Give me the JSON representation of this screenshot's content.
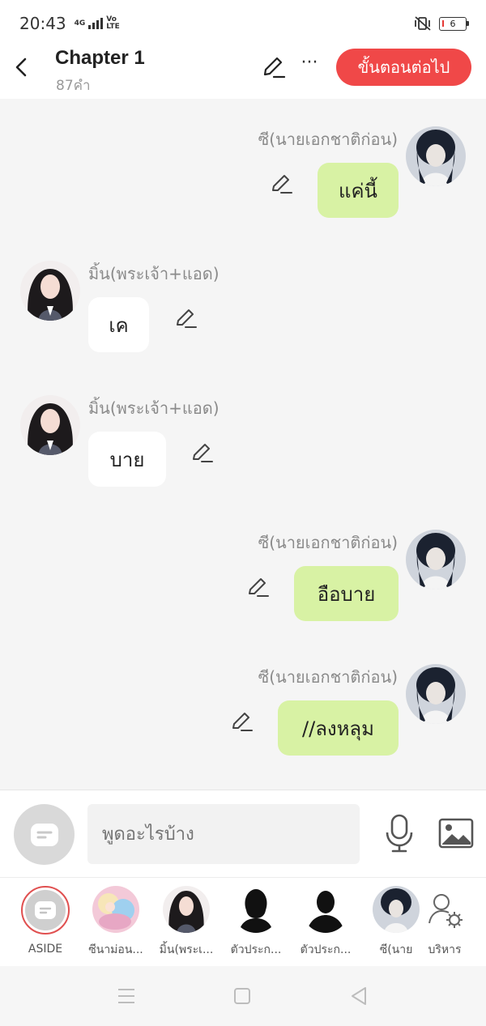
{
  "status_bar": {
    "time": "20:43",
    "network": "4G",
    "volte": "Vo LTE",
    "battery": "6"
  },
  "header": {
    "title": "Chapter 1",
    "word_count": "87คำ",
    "next_button": "ขั้นตอนต่อไป",
    "more_label": "···"
  },
  "messages": [
    {
      "side": "right",
      "name": "ซี(นายเอกชาติก่อน)",
      "text": "แค่นี้"
    },
    {
      "side": "left",
      "name": "มิ้น(พระเจ้า+แอด)",
      "text": "เค"
    },
    {
      "side": "left",
      "name": "มิ้น(พระเจ้า+แอด)",
      "text": "บาย"
    },
    {
      "side": "right",
      "name": "ซี(นายเอกชาติก่อน)",
      "text": "อือบาย"
    },
    {
      "side": "right",
      "name": "ซี(นายเอกชาติก่อน)",
      "text": "//ลงหลุม"
    }
  ],
  "input": {
    "placeholder": "พูดอะไรบ้าง"
  },
  "characters": [
    {
      "label": "ASIDE",
      "icon": "aside-icon"
    },
    {
      "label": "ซีนาม่อน...",
      "icon": "character-avatar"
    },
    {
      "label": "มิ้น(พระเ...",
      "icon": "character-avatar"
    },
    {
      "label": "ตัวประก...",
      "icon": "silhouette-avatar"
    },
    {
      "label": "ตัวประก...",
      "icon": "silhouette-avatar"
    },
    {
      "label": "ซี(นาย",
      "icon": "character-avatar"
    },
    {
      "label": "บริหาร",
      "icon": "manage-characters-icon"
    }
  ],
  "colors": {
    "accent": "#f04848",
    "bubble_self": "#d8f2a4",
    "bubble_other": "#ffffff",
    "background": "#f5f5f5"
  }
}
